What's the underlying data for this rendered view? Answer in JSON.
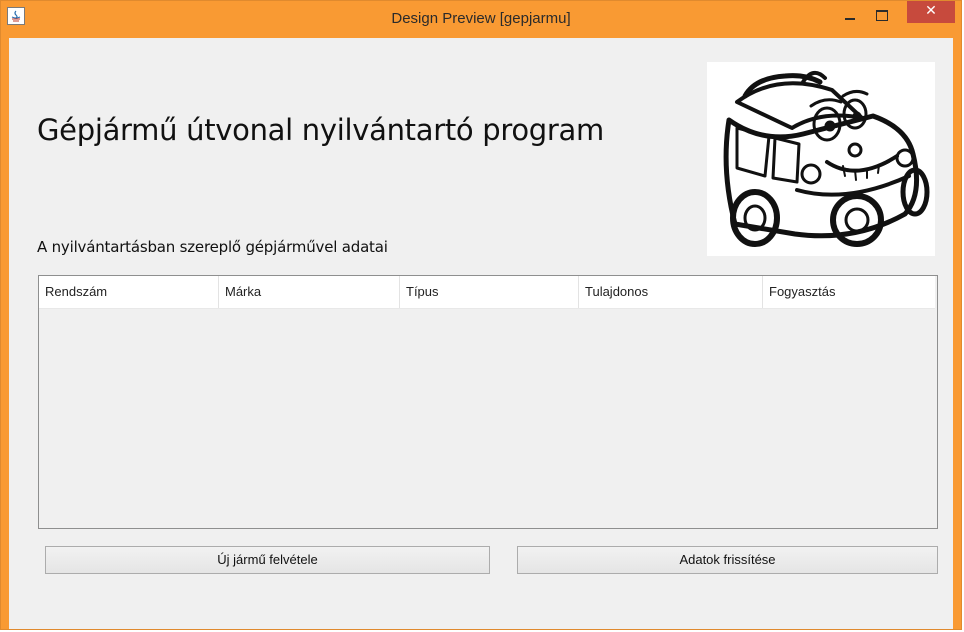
{
  "window": {
    "title": "Design Preview [gepjarmu]",
    "close_symbol": "✕",
    "accent_color": "#f99a33",
    "close_color": "#c74a3d"
  },
  "header": {
    "title": "Gépjármű útvonal nyilvántartó program",
    "subtitle": "A nyilvántartásban szereplő gépjárművel adatai",
    "image_icon": "cartoon-car-icon"
  },
  "table": {
    "columns": [
      "Rendszám",
      "Márka",
      "Típus",
      "Tulajdonos",
      "Fogyasztás"
    ],
    "rows": []
  },
  "buttons": {
    "new_vehicle": "Új jármű felvétele",
    "refresh": "Adatok frissítése"
  }
}
